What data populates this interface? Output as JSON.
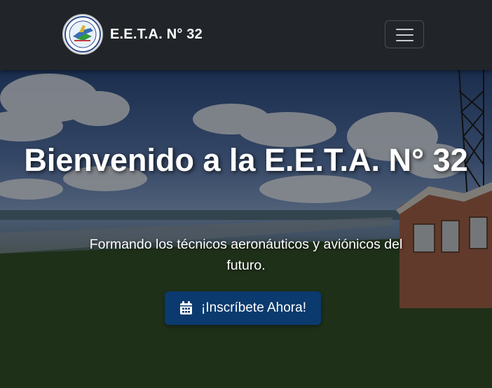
{
  "navbar": {
    "brand": "E.E.T.A. N° 32",
    "logo_icon": "school-crest-icon",
    "toggler_icon": "hamburger-menu-icon"
  },
  "hero": {
    "title": "Bienvenido a la E.E.T.A. N° 32",
    "subtitle": "Formando los técnicos aeronáuticos y aviónicos del futuro.",
    "cta_label": "¡Inscríbete Ahora!",
    "cta_icon": "calendar-icon"
  },
  "colors": {
    "navbar_bg": "#212529",
    "cta_bg": "#0b3a6e",
    "text": "#ffffff"
  }
}
